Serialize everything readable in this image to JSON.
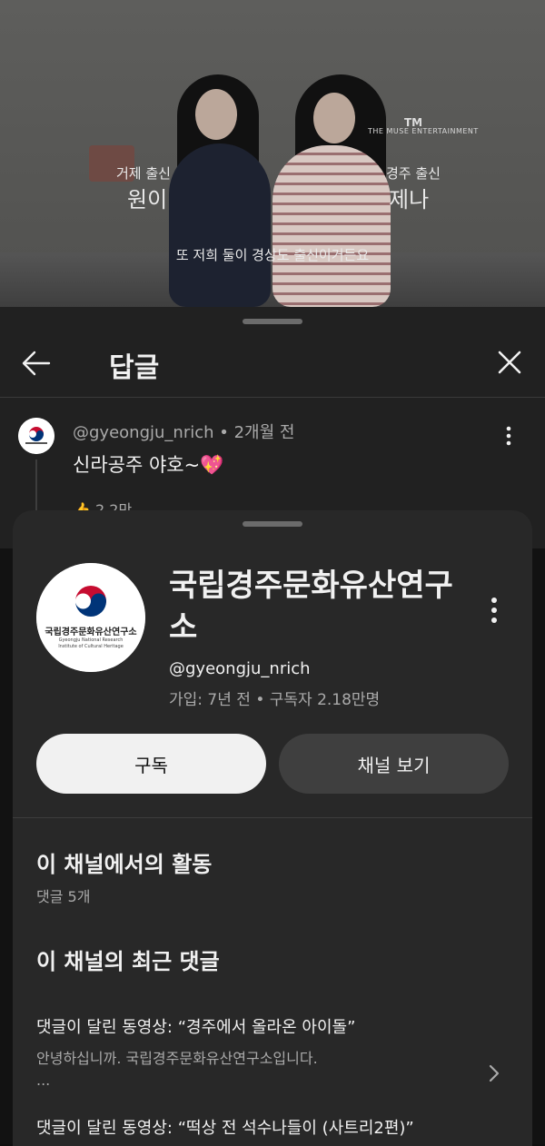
{
  "video": {
    "left_caption_line1": "거제 출신",
    "left_caption_line2": "원이",
    "right_caption_line1": "경주 출신",
    "right_caption_line2": "제나",
    "subtitle": "또 저희 둘이 경상도 출신이거든요",
    "brand": "THE MUSE ENTERTAINMENT",
    "brand_mark": "TM"
  },
  "replies_sheet": {
    "title": "답글",
    "back_icon": "arrow-left-icon",
    "close_icon": "close-icon"
  },
  "comment": {
    "author": "@gyeongju_nrich",
    "time": "2개월 전",
    "text": "신라공주 야호~💖",
    "actions_label": "2.2만"
  },
  "channel_card": {
    "name": "국립경주문화유산연구소",
    "handle": "@gyeongju_nrich",
    "meta": "가입: 7년 전 • 구독자 2.18만명",
    "avatar_text": "국립경주문화유산연구소",
    "avatar_subtext": "Gyeongju National Research Institute of Cultural Heritage",
    "subscribe_label": "구독",
    "view_channel_label": "채널 보기",
    "activity_title": "이 채널에서의 활동",
    "activity_sub": "댓글 5개",
    "recent_title": "이 채널의 최근 댓글",
    "recent_comments": [
      {
        "video": "댓글이 달린 동영상: “경주에서 올라온 아이돌”",
        "body": "안녕하십니까. 국립경주문화유산연구소입니다.",
        "ellipsis": "..."
      },
      {
        "video": "댓글이 달린 동영상: “떡상 전 석수나들이 (사트리2편)”"
      }
    ]
  },
  "colors": {
    "sheet_bg": "#212121",
    "card_bg": "#282828",
    "subscribe_bg": "#f1f1f1",
    "secondary_btn_bg": "#3f3f3f",
    "meta_text": "#aaaaaa"
  }
}
